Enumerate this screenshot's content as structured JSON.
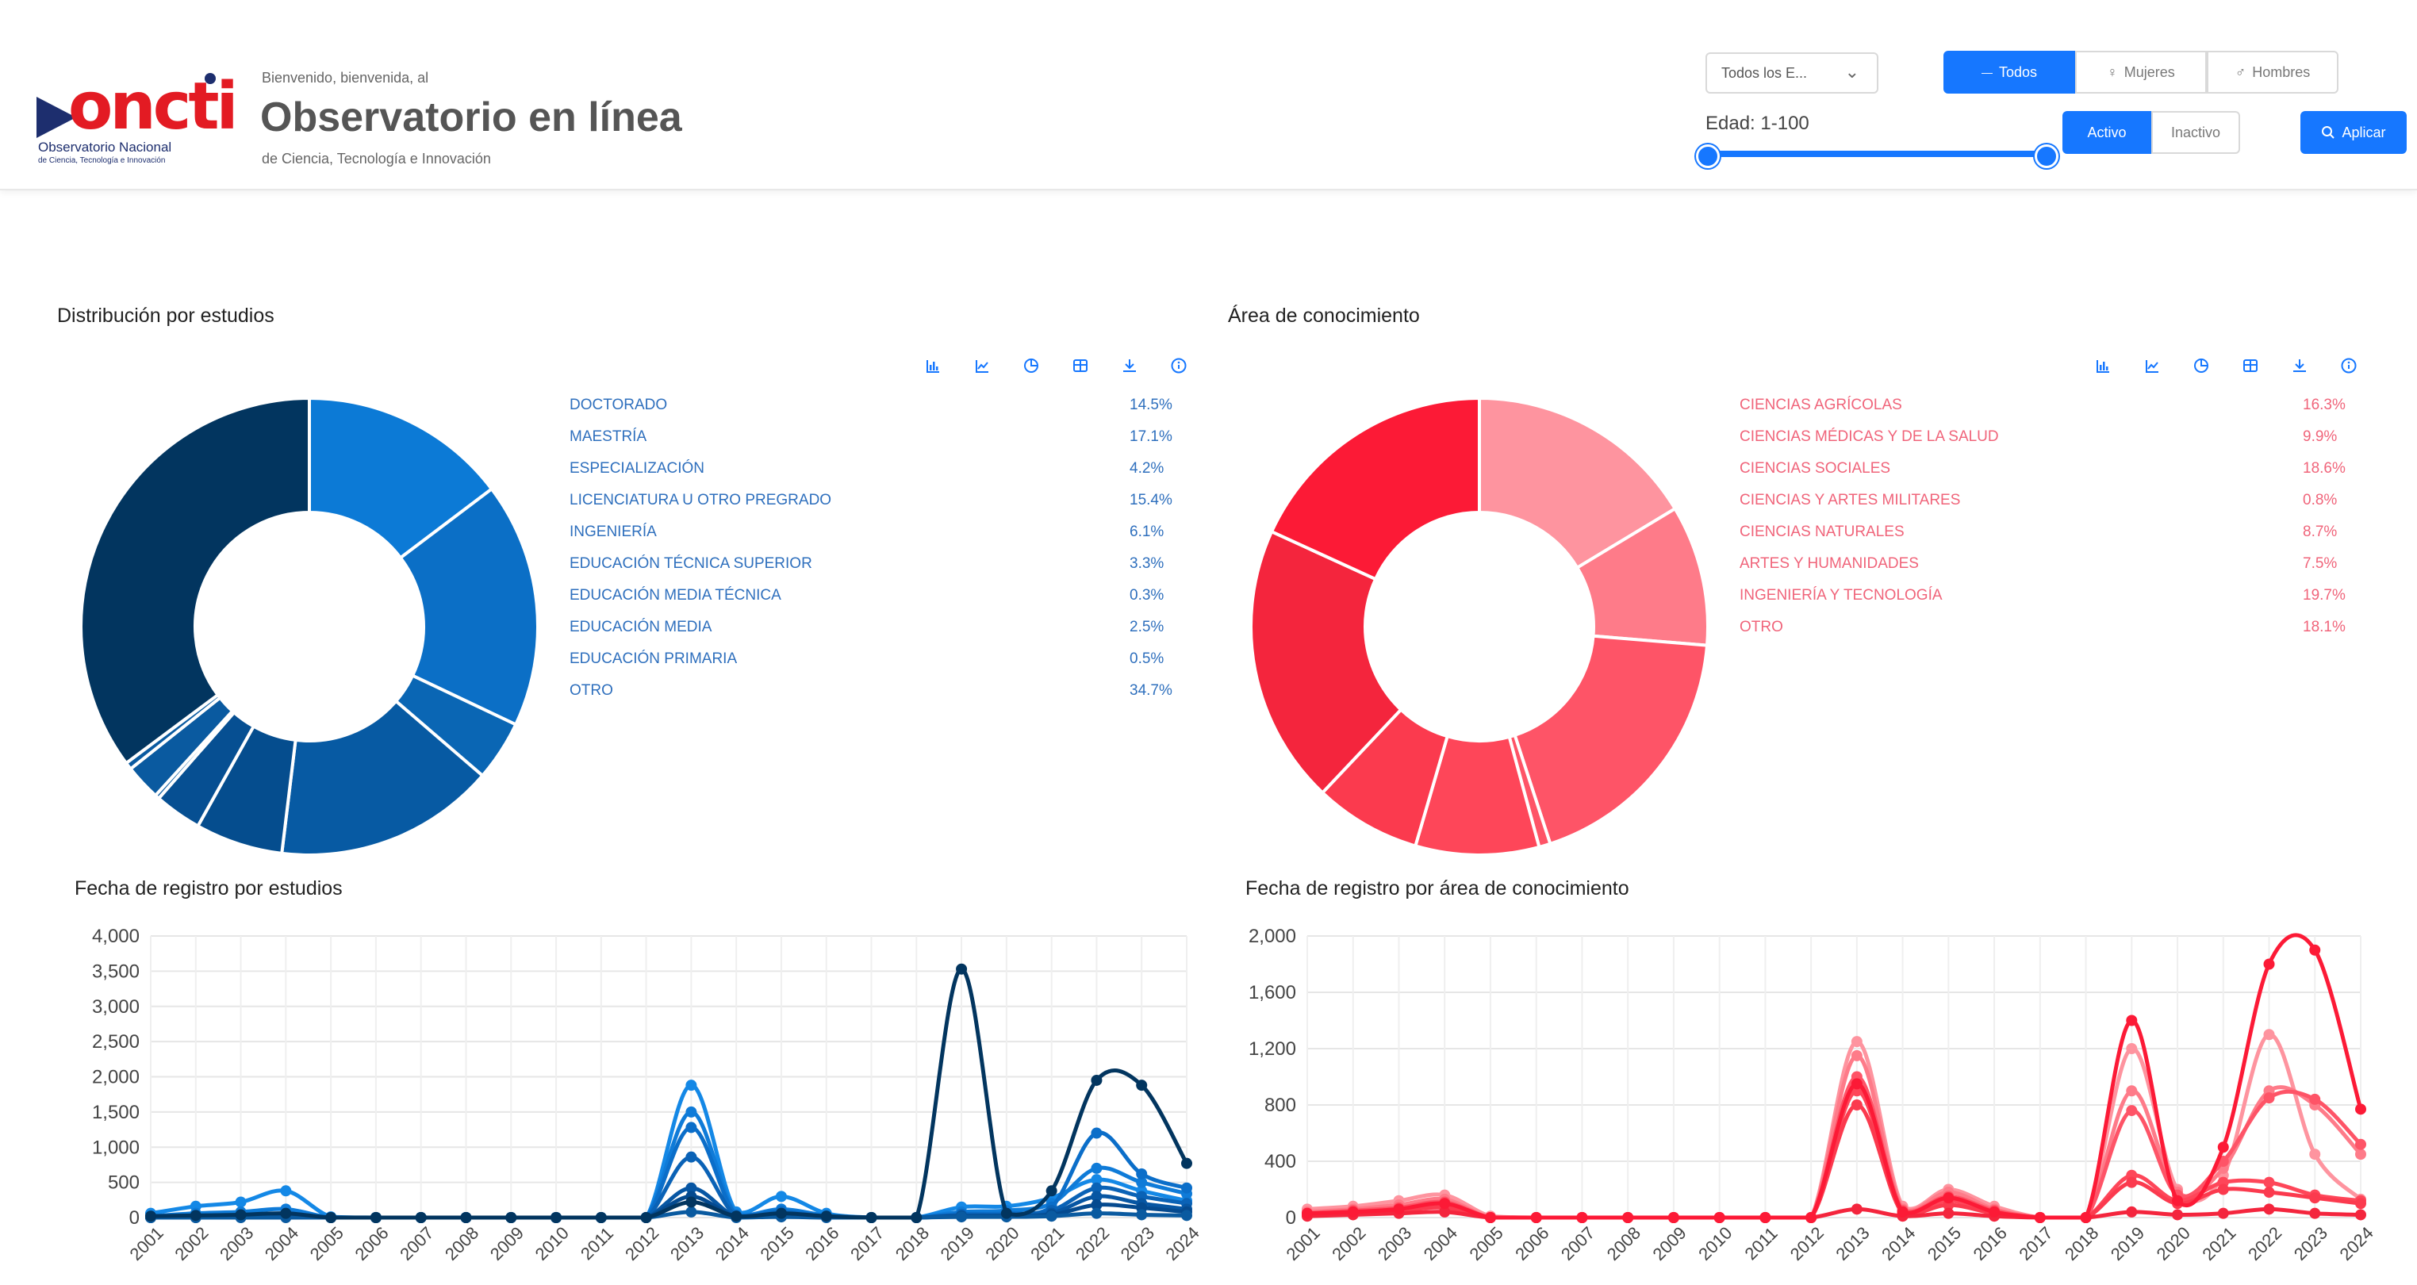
{
  "header": {
    "logo": {
      "word": "oncti",
      "line1": "Observatorio Nacional",
      "line2": "de Ciencia, Tecnología e Innovación"
    },
    "welcome": "Bienvenido, bienvenida, al",
    "title": "Observatorio en línea",
    "subtitle": "de Ciencia, Tecnología e Innovación"
  },
  "filters": {
    "estudios_select": "Todos los E...",
    "gender_options": [
      "Todos",
      "Mujeres",
      "Hombres"
    ],
    "gender_selected": "Todos",
    "edad_label": "Edad: 1-100",
    "edad_range": [
      1,
      100
    ],
    "status_options": [
      "Activo",
      "Inactivo"
    ],
    "status_selected": "Activo",
    "apply_label": "Aplicar"
  },
  "colors": {
    "primary": "#1677ff",
    "estudios_text": "#2e6fbd",
    "area_text": "#f0647a"
  },
  "toolbar_icons": [
    "bar-chart-icon",
    "line-chart-icon",
    "pie-chart-icon",
    "table-icon",
    "download-icon",
    "info-icon"
  ],
  "chart_data": [
    {
      "type": "pie",
      "title": "Distribución por estudios",
      "donut": true,
      "legend_position": "right",
      "labels": [
        "DOCTORADO",
        "MAESTRÍA",
        "ESPECIALIZACIÓN",
        "LICENCIATURA U OTRO PREGRADO",
        "INGENIERÍA",
        "EDUCACIÓN TÉCNICA SUPERIOR",
        "EDUCACIÓN MEDIA TÉCNICA",
        "EDUCACIÓN MEDIA",
        "EDUCACIÓN PRIMARIA",
        "OTRO"
      ],
      "values": [
        14.5,
        17.1,
        4.2,
        15.4,
        6.1,
        3.3,
        0.3,
        2.5,
        0.5,
        34.7
      ],
      "value_labels": [
        "14.5%",
        "17.1%",
        "4.2%",
        "15.4%",
        "6.1%",
        "3.3%",
        "0.3%",
        "2.5%",
        "0.5%",
        "34.7%"
      ],
      "colors": [
        "#0c7ad6",
        "#0b6fc6",
        "#0a66b4",
        "#075aa3",
        "#054d8e",
        "#064f92",
        "#0a5aa0",
        "#0a5aa0",
        "#0a5aa0",
        "#02355f"
      ]
    },
    {
      "type": "pie",
      "title": "Área de conocimiento",
      "donut": true,
      "legend_position": "right",
      "labels": [
        "CIENCIAS AGRÍCOLAS",
        "CIENCIAS MÉDICAS Y DE LA SALUD",
        "CIENCIAS SOCIALES",
        "CIENCIAS Y ARTES MILITARES",
        "CIENCIAS NATURALES",
        "ARTES Y HUMANIDADES",
        "INGENIERÍA Y TECNOLOGÍA",
        "OTRO"
      ],
      "values": [
        16.3,
        9.9,
        18.6,
        0.8,
        8.7,
        7.5,
        19.7,
        18.1
      ],
      "value_labels": [
        "16.3%",
        "9.9%",
        "18.6%",
        "0.8%",
        "8.7%",
        "7.5%",
        "19.7%",
        "18.1%"
      ],
      "colors": [
        "#fe949f",
        "#fe7b89",
        "#fe5467",
        "#fe5467",
        "#fe4659",
        "#fb3a4e",
        "#f4253d",
        "#fc1a36"
      ]
    },
    {
      "type": "line",
      "title": "Fecha de registro por estudios",
      "x": [
        "2001",
        "2002",
        "2003",
        "2004",
        "2005",
        "2006",
        "2007",
        "2008",
        "2009",
        "2010",
        "2011",
        "2012",
        "2013",
        "2014",
        "2015",
        "2016",
        "2017",
        "2018",
        "2019",
        "2020",
        "2021",
        "2022",
        "2023",
        "2024"
      ],
      "ylim": [
        0,
        4000
      ],
      "yticks": [
        0,
        500,
        1000,
        1500,
        2000,
        2500,
        3000,
        3500,
        4000
      ],
      "ytick_labels": [
        "0",
        "500",
        "1,000",
        "1,500",
        "2,000",
        "2,500",
        "3,000",
        "3,500",
        "4,000"
      ],
      "grid": true,
      "series": [
        {
          "color": "#1488e6",
          "values": [
            60,
            160,
            220,
            380,
            10,
            0,
            0,
            0,
            0,
            0,
            0,
            0,
            1880,
            80,
            300,
            60,
            0,
            0,
            150,
            160,
            280,
            540,
            380,
            240
          ]
        },
        {
          "color": "#0f7bd8",
          "values": [
            20,
            60,
            80,
            120,
            0,
            0,
            0,
            0,
            0,
            0,
            0,
            0,
            1500,
            40,
            120,
            30,
            0,
            0,
            80,
            100,
            200,
            700,
            500,
            340
          ]
        },
        {
          "color": "#0b6ec9",
          "values": [
            10,
            20,
            30,
            50,
            0,
            0,
            0,
            0,
            0,
            0,
            0,
            0,
            1280,
            30,
            90,
            20,
            0,
            0,
            50,
            60,
            150,
            1200,
            620,
            420
          ]
        },
        {
          "color": "#0a62b6",
          "values": [
            10,
            10,
            20,
            30,
            0,
            0,
            0,
            0,
            0,
            0,
            0,
            0,
            860,
            20,
            50,
            10,
            0,
            0,
            40,
            40,
            100,
            420,
            300,
            200
          ]
        },
        {
          "color": "#0756a3",
          "values": [
            0,
            10,
            10,
            20,
            0,
            0,
            0,
            0,
            0,
            0,
            0,
            0,
            420,
            10,
            30,
            10,
            0,
            0,
            20,
            30,
            60,
            300,
            200,
            120
          ]
        },
        {
          "color": "#054a8f",
          "values": [
            0,
            0,
            10,
            10,
            0,
            0,
            0,
            0,
            0,
            0,
            0,
            0,
            300,
            10,
            20,
            10,
            0,
            0,
            20,
            20,
            40,
            180,
            140,
            80
          ]
        },
        {
          "color": "#0a5aa0",
          "values": [
            0,
            0,
            0,
            0,
            0,
            0,
            0,
            0,
            0,
            0,
            0,
            0,
            80,
            0,
            10,
            0,
            0,
            0,
            10,
            10,
            20,
            60,
            40,
            30
          ]
        },
        {
          "color": "#02355f",
          "values": [
            20,
            30,
            40,
            60,
            0,
            0,
            0,
            0,
            0,
            0,
            0,
            0,
            220,
            20,
            60,
            20,
            0,
            0,
            3530,
            60,
            380,
            1950,
            1880,
            770
          ]
        }
      ]
    },
    {
      "type": "line",
      "title": "Fecha de registro por área de conocimiento",
      "x": [
        "2001",
        "2002",
        "2003",
        "2004",
        "2005",
        "2006",
        "2007",
        "2008",
        "2009",
        "2010",
        "2011",
        "2012",
        "2013",
        "2014",
        "2015",
        "2016",
        "2017",
        "2018",
        "2019",
        "2020",
        "2021",
        "2022",
        "2023",
        "2024"
      ],
      "ylim": [
        0,
        2000
      ],
      "yticks": [
        0,
        400,
        800,
        1200,
        1600,
        2000
      ],
      "ytick_labels": [
        "0",
        "400",
        "800",
        "1,200",
        "1,600",
        "2,000"
      ],
      "grid": true,
      "series": [
        {
          "color": "#fe949f",
          "values": [
            60,
            80,
            120,
            160,
            10,
            0,
            0,
            0,
            0,
            0,
            0,
            0,
            1250,
            80,
            200,
            80,
            0,
            0,
            1200,
            200,
            300,
            1300,
            450,
            130
          ]
        },
        {
          "color": "#fe7b89",
          "values": [
            40,
            60,
            90,
            130,
            0,
            0,
            0,
            0,
            0,
            0,
            0,
            0,
            1150,
            60,
            180,
            60,
            0,
            0,
            900,
            180,
            350,
            900,
            800,
            450
          ]
        },
        {
          "color": "#fe5467",
          "values": [
            30,
            50,
            70,
            110,
            0,
            0,
            0,
            0,
            0,
            0,
            0,
            0,
            1000,
            50,
            150,
            50,
            0,
            0,
            760,
            160,
            400,
            850,
            840,
            520
          ]
        },
        {
          "color": "#fe4659",
          "values": [
            20,
            40,
            60,
            90,
            0,
            0,
            0,
            0,
            0,
            0,
            0,
            0,
            900,
            40,
            120,
            40,
            0,
            0,
            300,
            120,
            250,
            250,
            160,
            120
          ]
        },
        {
          "color": "#fb3a4e",
          "values": [
            20,
            30,
            50,
            70,
            0,
            0,
            0,
            0,
            0,
            0,
            0,
            0,
            800,
            30,
            90,
            30,
            0,
            0,
            250,
            100,
            200,
            180,
            140,
            100
          ]
        },
        {
          "color": "#f4253d",
          "values": [
            10,
            20,
            30,
            40,
            0,
            0,
            0,
            0,
            0,
            0,
            0,
            0,
            60,
            10,
            30,
            10,
            0,
            0,
            40,
            20,
            30,
            60,
            30,
            20
          ]
        },
        {
          "color": "#fc1a36",
          "values": [
            30,
            40,
            60,
            100,
            0,
            0,
            0,
            0,
            0,
            0,
            0,
            0,
            950,
            40,
            140,
            40,
            0,
            0,
            1400,
            120,
            500,
            1800,
            1900,
            770
          ]
        }
      ]
    }
  ]
}
